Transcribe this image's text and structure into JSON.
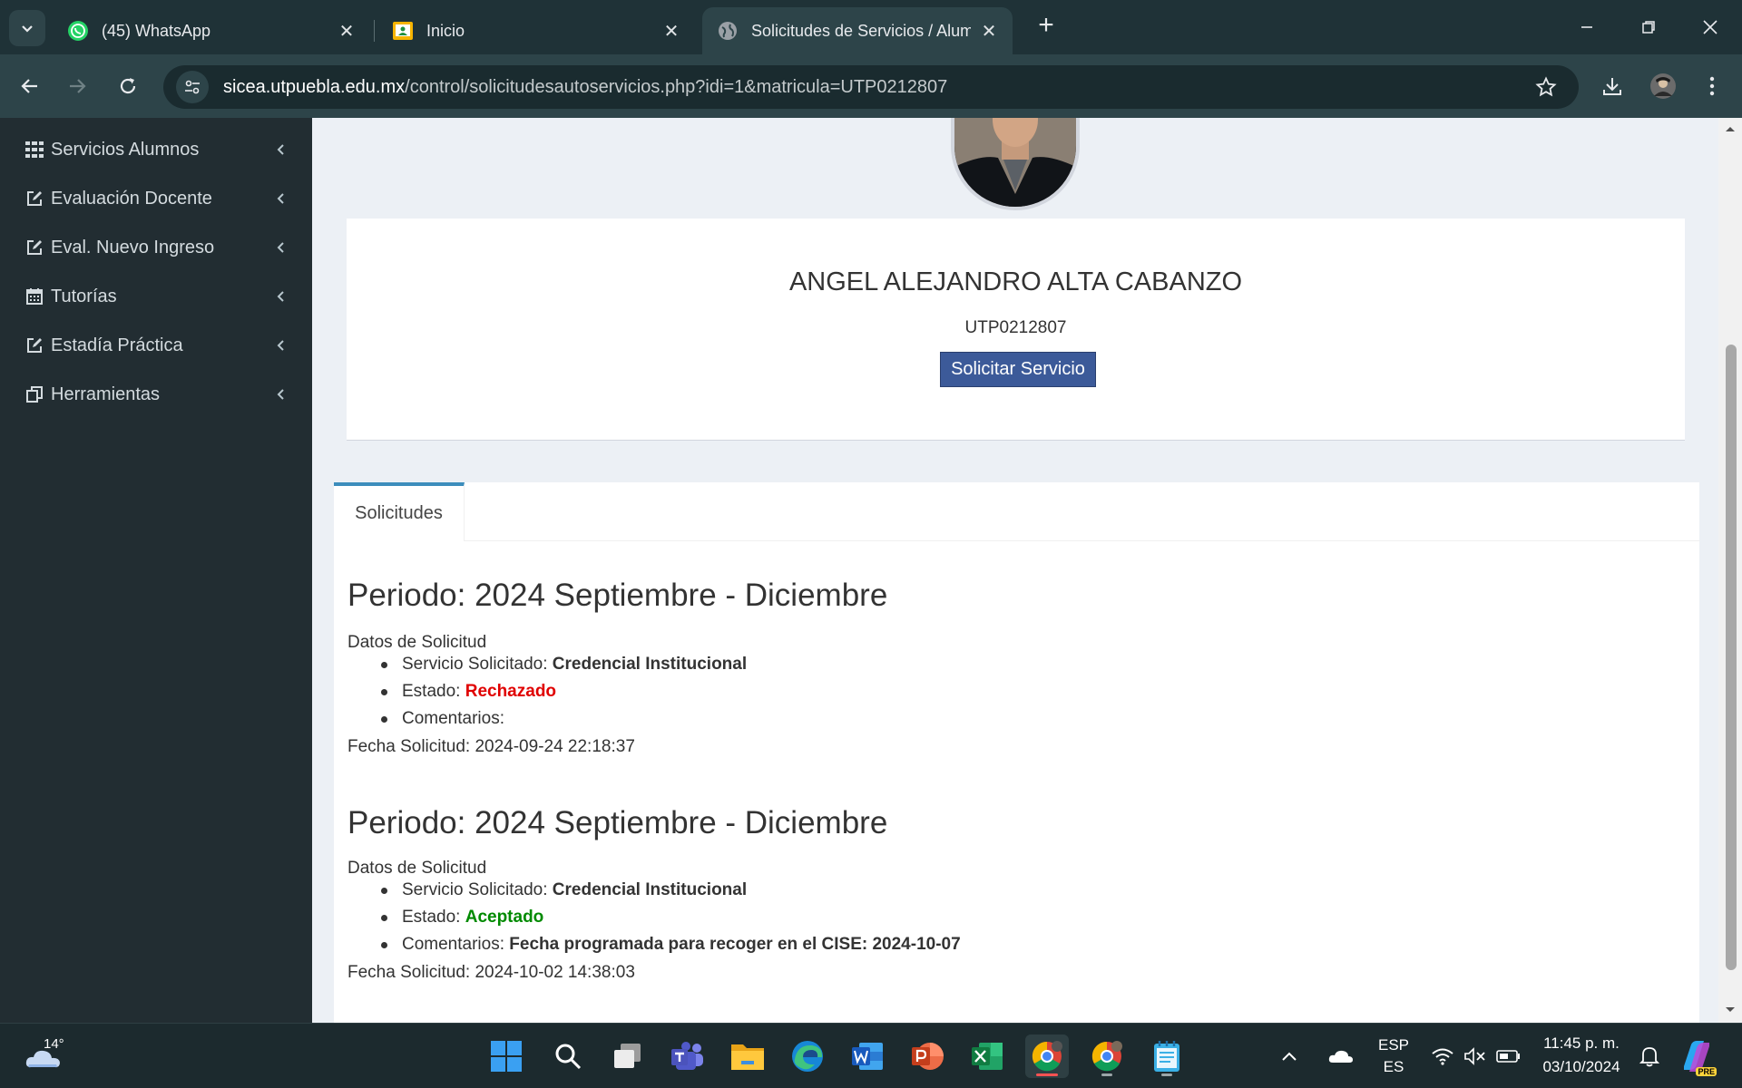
{
  "browser": {
    "tabs": [
      {
        "title": "(45) WhatsApp",
        "icon": "whatsapp-icon",
        "active": false
      },
      {
        "title": "Inicio",
        "icon": "classroom-icon",
        "active": false
      },
      {
        "title": "Solicitudes de Servicios / Alumn",
        "icon": "globe-icon",
        "active": true
      }
    ],
    "url_domain": "sicea.utpuebla.edu.mx",
    "url_path": "/control/solicitudesautoservicios.php?idi=1&matricula=UTP0212807"
  },
  "sidebar": {
    "items": [
      {
        "label": "Servicios Alumnos",
        "icon": "grid-icon"
      },
      {
        "label": "Evaluación Docente",
        "icon": "edit-icon"
      },
      {
        "label": "Eval. Nuevo Ingreso",
        "icon": "edit-icon"
      },
      {
        "label": "Tutorías",
        "icon": "calendar-icon"
      },
      {
        "label": "Estadía Práctica",
        "icon": "edit-icon"
      },
      {
        "label": "Herramientas",
        "icon": "copy-icon"
      }
    ]
  },
  "profile": {
    "name": "ANGEL ALEJANDRO ALTA CABANZO",
    "matricula": "UTP0212807",
    "request_button": "Solicitar Servicio"
  },
  "tabs": {
    "solicitudes": "Solicitudes"
  },
  "requests": [
    {
      "period": "Periodo: 2024 Septiembre - Diciembre",
      "datos_label": "Datos de Solicitud",
      "service_label": "Servicio Solicitado: ",
      "service": "Credencial Institucional",
      "status_label": "Estado: ",
      "status": "Rechazado",
      "status_color": "#e00000",
      "comments_label": "Comentarios: ",
      "comments": "",
      "date": "Fecha Solicitud: 2024-09-24 22:18:37"
    },
    {
      "period": "Periodo: 2024 Septiembre - Diciembre",
      "datos_label": "Datos de Solicitud",
      "service_label": "Servicio Solicitado: ",
      "service": "Credencial Institucional",
      "status_label": "Estado: ",
      "status": "Aceptado",
      "status_color": "#008a00",
      "comments_label": "Comentarios: ",
      "comments": "Fecha programada para recoger en el CISE: 2024-10-07",
      "date": "Fecha Solicitud: 2024-10-02 14:38:03"
    }
  ],
  "taskbar": {
    "weather_temp": "14°",
    "lang_top": "ESP",
    "lang_bottom": "ES",
    "time": "11:45 p. m.",
    "date": "03/10/2024",
    "copilot_badge": "PRE"
  }
}
